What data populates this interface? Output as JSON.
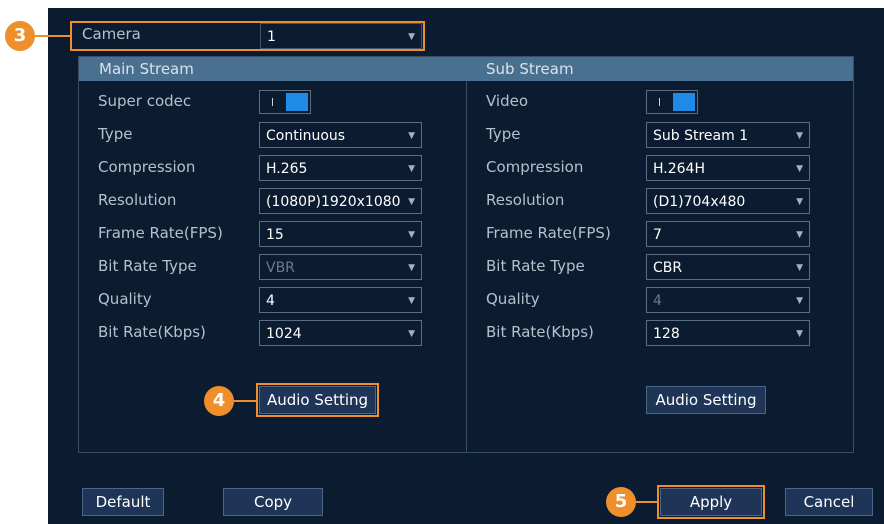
{
  "camera": {
    "label": "Camera",
    "value": "1"
  },
  "main": {
    "title": "Main Stream",
    "rows": [
      {
        "label": "Super codec"
      },
      {
        "label": "Type",
        "value": "Continuous"
      },
      {
        "label": "Compression",
        "value": "H.265"
      },
      {
        "label": "Resolution",
        "value": "(1080P)1920x1080"
      },
      {
        "label": "Frame Rate(FPS)",
        "value": "15"
      },
      {
        "label": "Bit Rate Type",
        "value": "VBR"
      },
      {
        "label": "Quality",
        "value": "4"
      },
      {
        "label": "Bit Rate(Kbps)",
        "value": "1024"
      }
    ],
    "audio_button": "Audio Setting"
  },
  "sub": {
    "title": "Sub Stream",
    "rows": [
      {
        "label": "Video"
      },
      {
        "label": "Type",
        "value": "Sub Stream 1"
      },
      {
        "label": "Compression",
        "value": "H.264H"
      },
      {
        "label": "Resolution",
        "value": "(D1)704x480"
      },
      {
        "label": "Frame Rate(FPS)",
        "value": "7"
      },
      {
        "label": "Bit Rate Type",
        "value": "CBR"
      },
      {
        "label": "Quality",
        "value": "4"
      },
      {
        "label": "Bit Rate(Kbps)",
        "value": "128"
      }
    ],
    "audio_button": "Audio Setting"
  },
  "footer": {
    "default": "Default",
    "copy": "Copy",
    "apply": "Apply",
    "cancel": "Cancel"
  },
  "callouts": [
    "3",
    "4",
    "5"
  ],
  "colors": {
    "background": "#0b1b30",
    "header": "#4a7090",
    "accent": "#ee8f2b",
    "toggle": "#1f8be6"
  }
}
